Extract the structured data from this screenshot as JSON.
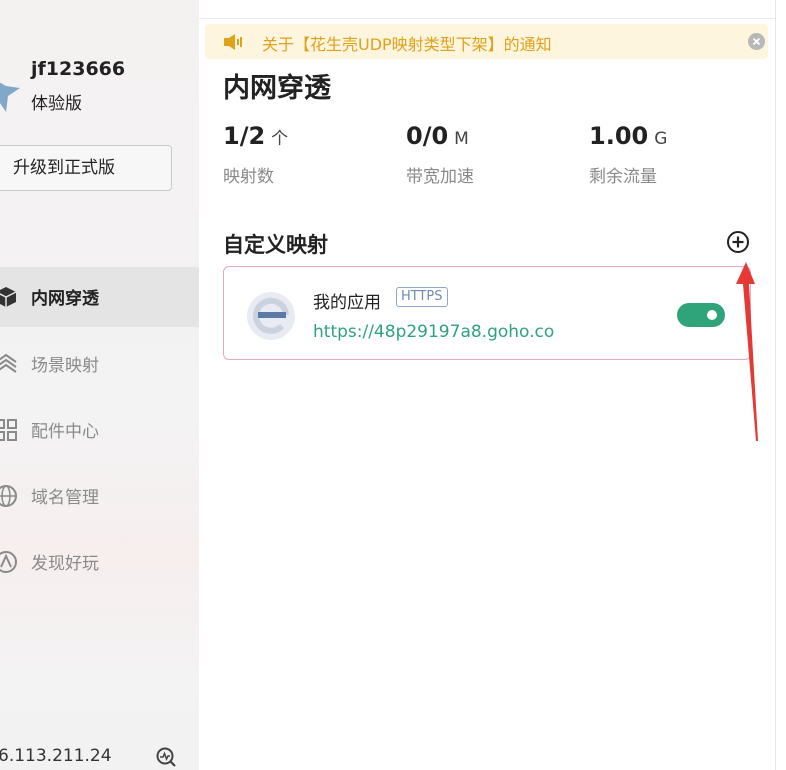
{
  "sidebar": {
    "username": "jf123666",
    "plan": "体验版",
    "upgrade_label": "升级到正式版",
    "nav": [
      {
        "label": "内网穿透",
        "icon": "cube-icon",
        "active": true
      },
      {
        "label": "场景映射",
        "icon": "layers-icon",
        "active": false
      },
      {
        "label": "配件中心",
        "icon": "grid-icon",
        "active": false
      },
      {
        "label": "域名管理",
        "icon": "globe-icon",
        "active": false
      },
      {
        "label": "发现好玩",
        "icon": "compass-icon",
        "active": false
      }
    ],
    "ip": "6.113.211.24"
  },
  "notice": {
    "text": "关于【花生壳UDP映射类型下架】的通知",
    "color": "#e0a11b"
  },
  "main": {
    "title": "内网穿透",
    "stats": [
      {
        "value": "1/2",
        "unit": "个",
        "label": "映射数"
      },
      {
        "value": "0/0",
        "unit": "M",
        "label": "带宽加速"
      },
      {
        "value": "1.00",
        "unit": "G",
        "label": "剩余流量"
      }
    ],
    "section_title": "自定义映射",
    "mapping": {
      "name": "我的应用",
      "protocol": "HTTPS",
      "url": "https://48p29197a8.goho.co",
      "enabled": true
    }
  },
  "colors": {
    "accent_green": "#2fa37a",
    "notice_bg": "#fdf5de",
    "card_border": "#e6a9c3",
    "arrow_red": "#e53935"
  }
}
